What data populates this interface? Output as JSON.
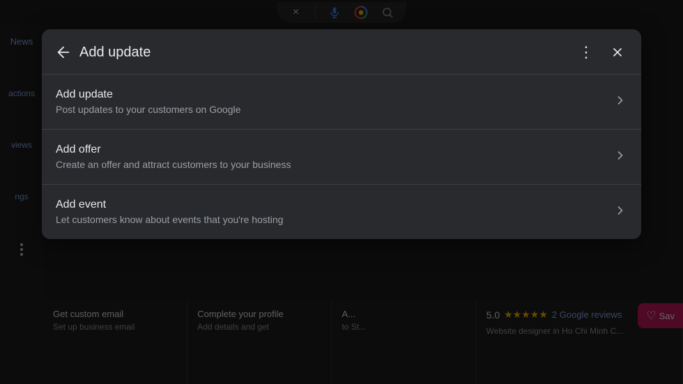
{
  "topbar": {
    "close_icon": "×",
    "mic_icon": "🎤",
    "search_icon": "🔍"
  },
  "sidebar": {
    "news_label": "News",
    "actions_label": "actions",
    "reviews_label": "views",
    "settings_label": "ngs"
  },
  "modal": {
    "back_icon": "←",
    "title": "Add update",
    "more_icon": "⋮",
    "close_icon": "×",
    "items": [
      {
        "title": "Add update",
        "description": "Post updates to your customers on Google"
      },
      {
        "title": "Add offer",
        "description": "Create an offer and attract customers to your business"
      },
      {
        "title": "Add event",
        "description": "Let customers know about events that you're hosting"
      }
    ]
  },
  "bottom_cards": [
    {
      "title": "Get custom email",
      "subtitle": "Set up business email"
    },
    {
      "title": "Complete your profile",
      "subtitle": "Add details and get"
    },
    {
      "title": "A...",
      "subtitle": "to St..."
    },
    {
      "rating": "5.0",
      "review_count": "2",
      "review_label": "Google reviews",
      "subtitle": "Website designer in Ho Chi Minh C..."
    }
  ],
  "save_button": {
    "label": "Sav",
    "icon": "♡"
  }
}
